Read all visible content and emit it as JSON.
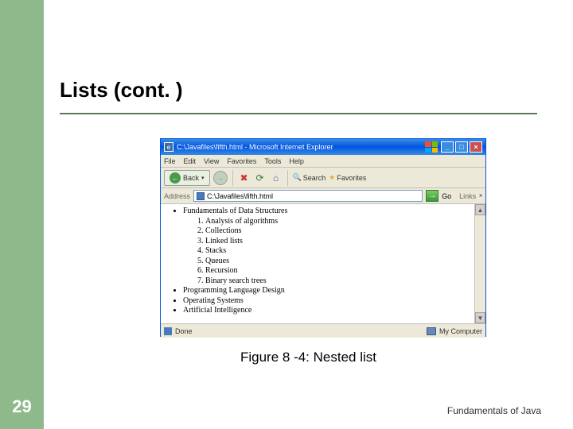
{
  "slide": {
    "title": "Lists (cont. )",
    "number": "29",
    "footer": "Fundamentals of Java",
    "caption": "Figure 8 -4: Nested list"
  },
  "browser": {
    "title": "C:\\Javafiles\\fifth.html - Microsoft Internet Explorer",
    "menu": [
      "File",
      "Edit",
      "View",
      "Favorites",
      "Tools",
      "Help"
    ],
    "toolbar": {
      "back": "Back",
      "search": "Search",
      "favorites": "Favorites"
    },
    "address": {
      "label": "Address",
      "value": "C:\\Javafiles\\fifth.html",
      "go": "Go",
      "links": "Links"
    },
    "content": {
      "items": [
        {
          "text": "Fundamentals of Data Structures",
          "sub": [
            "Analysis of algorithms",
            "Collections",
            "Linked lists",
            "Stacks",
            "Queues",
            "Recursion",
            "Binary search trees"
          ]
        },
        {
          "text": "Programming Language Design"
        },
        {
          "text": "Operating Systems"
        },
        {
          "text": "Artificial Intelligence"
        }
      ]
    },
    "status": {
      "done": "Done",
      "zone": "My Computer"
    }
  }
}
